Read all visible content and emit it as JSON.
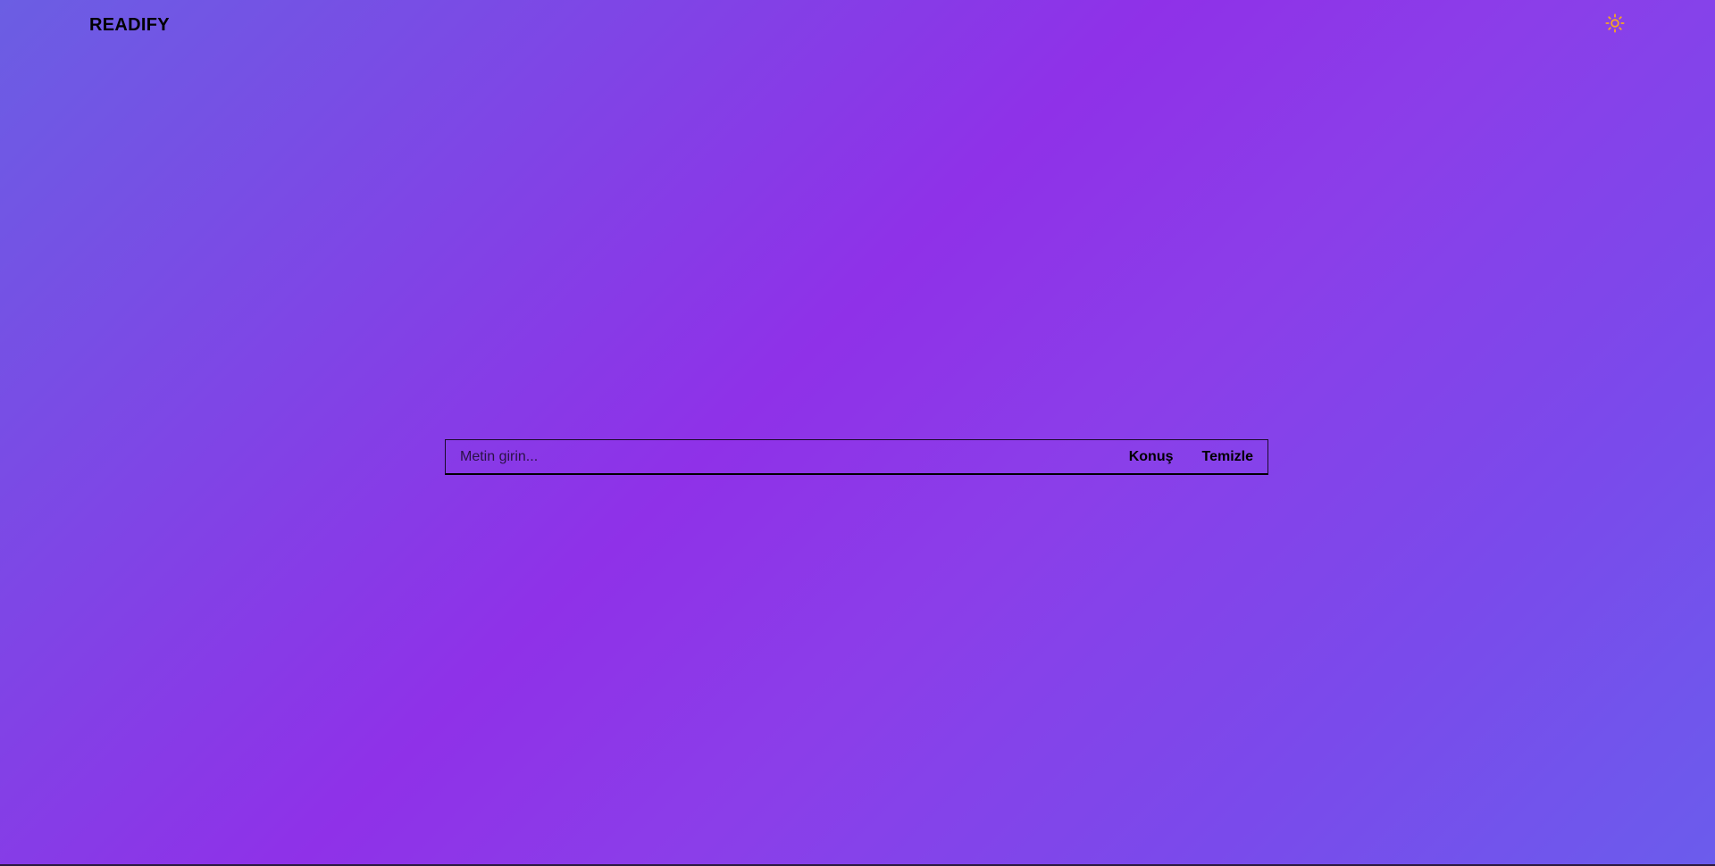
{
  "header": {
    "brand": "READIFY",
    "theme_icon": "sun-icon",
    "theme_icon_color": "#f5a623"
  },
  "input_bar": {
    "placeholder": "Metin girin...",
    "value": "",
    "speak_label": "Konuş",
    "clear_label": "Temizle"
  },
  "colors": {
    "gradient_start": "#6b5ee3",
    "gradient_mid": "#8f31e8",
    "gradient_end": "#6b5cec"
  }
}
